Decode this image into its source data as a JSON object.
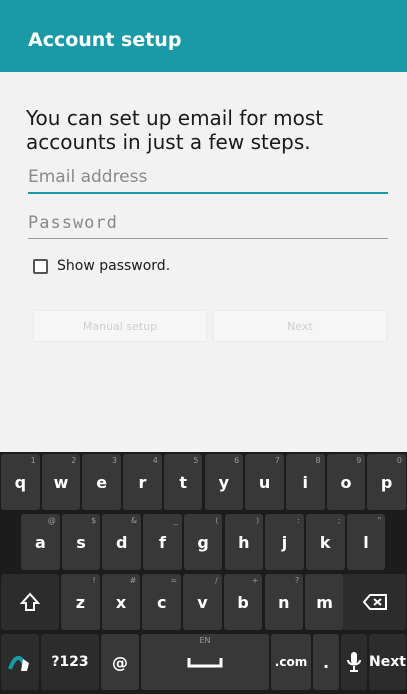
{
  "app_bar": {
    "title": "Account setup"
  },
  "main": {
    "intro": "You can set up email for most accounts in just a few steps.",
    "email": {
      "placeholder": "Email address",
      "value": ""
    },
    "password": {
      "placeholder": "Password",
      "value": ""
    },
    "show_password": {
      "label": "Show password.",
      "checked": false
    },
    "buttons": {
      "manual_setup": "Manual setup",
      "next": "Next"
    }
  },
  "keyboard": {
    "row1": [
      {
        "key": "q",
        "hint": "1"
      },
      {
        "key": "w",
        "hint": "2"
      },
      {
        "key": "e",
        "hint": "3"
      },
      {
        "key": "r",
        "hint": "4"
      },
      {
        "key": "t",
        "hint": "5"
      },
      {
        "key": "y",
        "hint": "6"
      },
      {
        "key": "u",
        "hint": "7"
      },
      {
        "key": "i",
        "hint": "8"
      },
      {
        "key": "o",
        "hint": "9"
      },
      {
        "key": "p",
        "hint": "0"
      }
    ],
    "row2": [
      {
        "key": "a",
        "hint": "@"
      },
      {
        "key": "s",
        "hint": "$"
      },
      {
        "key": "d",
        "hint": "&"
      },
      {
        "key": "f",
        "hint": "_"
      },
      {
        "key": "g",
        "hint": "("
      },
      {
        "key": "h",
        "hint": ")"
      },
      {
        "key": "j",
        "hint": ":"
      },
      {
        "key": "k",
        "hint": ";"
      },
      {
        "key": "l",
        "hint": "\""
      }
    ],
    "row3": [
      {
        "key": "z",
        "hint": "!"
      },
      {
        "key": "x",
        "hint": "#"
      },
      {
        "key": "c",
        "hint": "="
      },
      {
        "key": "v",
        "hint": "/"
      },
      {
        "key": "b",
        "hint": "+"
      },
      {
        "key": "n",
        "hint": "?"
      },
      {
        "key": "m",
        "hint": ""
      }
    ],
    "row4": {
      "symbols": "?123",
      "at": "@",
      "space_hint": "EN",
      "dotcom": ".com",
      "period": ".",
      "next": "Next"
    },
    "accent_color": "#1a9aa6"
  }
}
